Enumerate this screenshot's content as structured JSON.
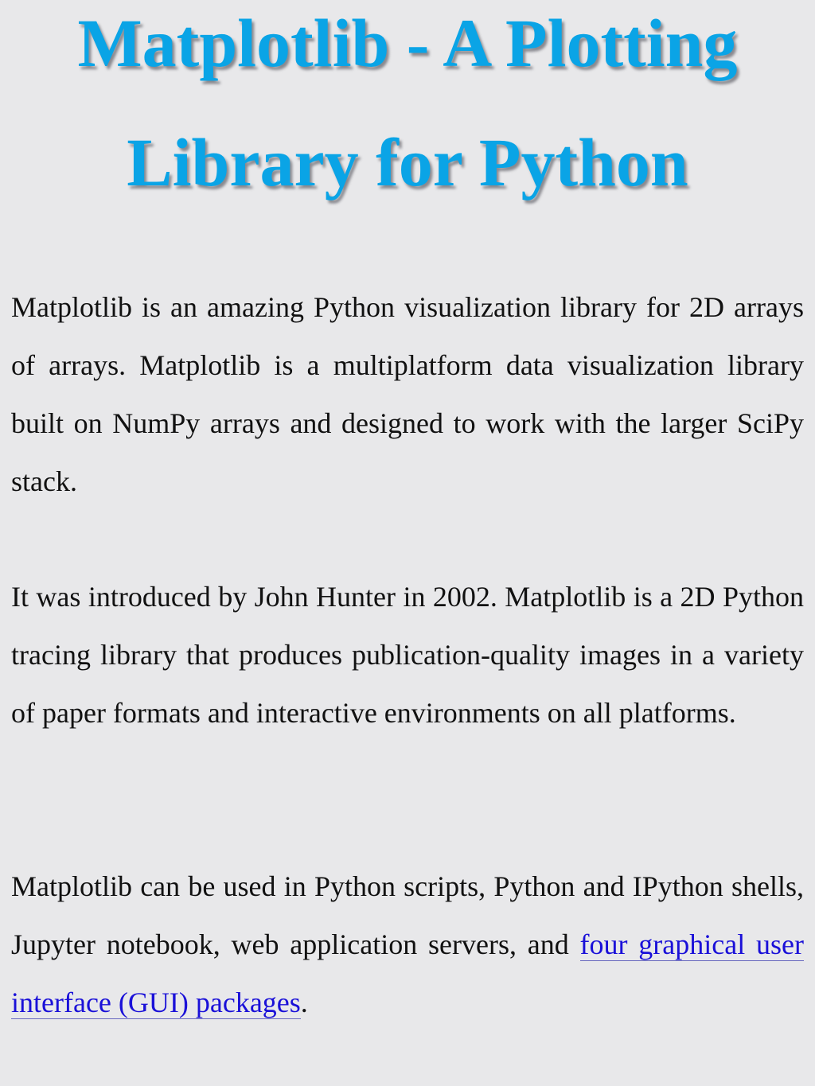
{
  "title": {
    "line1": "Matplotlib - A Plotting",
    "line2": "Library for Python",
    "color": "#0aa4e6"
  },
  "paragraphs": [
    {
      "text": "Matplotlib is an amazing Python visualization library for 2D arrays of arrays. Matplotlib is a multiplatform data visualization library built on NumPy arrays and designed to work with the larger SciPy stack."
    },
    {
      "text": "It was introduced by John Hunter in 2002. Matplotlib is a 2D Python tracing library that produces publication-quality images in a variety of paper formats and interactive environments on all platforms."
    },
    {
      "text_before_link": "Matplotlib can be used in Python scripts, Python and IPython shells, Jupyter notebook, web application servers, and ",
      "link_text": "four graphical user interface (GUI) packages",
      "text_after_link": "."
    }
  ],
  "colors": {
    "background": "#e8e8ea",
    "body_text": "#111111",
    "link": "#1a10d8"
  }
}
